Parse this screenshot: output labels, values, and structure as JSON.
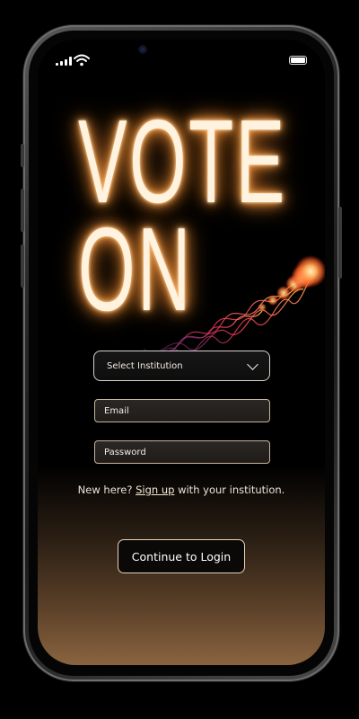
{
  "logo": {
    "line1": "VOTE",
    "line2": "ON"
  },
  "status_bar": {
    "signal_icon": "cellular-signal-icon",
    "wifi_icon": "wifi-icon",
    "battery_icon": "battery-icon",
    "battery_level": 1.0
  },
  "form": {
    "institution_select": {
      "value": "Select Institution",
      "icon": "chevron-down-icon"
    },
    "email": {
      "placeholder": "Email"
    },
    "password": {
      "placeholder": "Password"
    }
  },
  "signup": {
    "prefix": "New here?",
    "link": "Sign up",
    "suffix": "with your institution."
  },
  "login_button": {
    "label": "Continue to Login"
  },
  "colors": {
    "accent_glow": "#ff9a3c",
    "field_border": "#c9b39a",
    "gradient_bottom": "#8a6440"
  }
}
